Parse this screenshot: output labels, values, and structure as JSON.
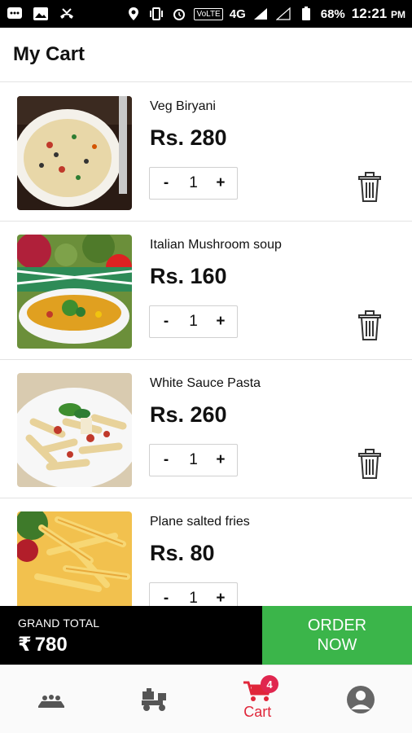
{
  "status_bar": {
    "volte": "VoLTE",
    "network": "4G",
    "battery": "68%",
    "time": "12:21",
    "ampm": "PM"
  },
  "header": {
    "title": "My Cart"
  },
  "cart": {
    "items": [
      {
        "name": "Veg Biryani",
        "price": "Rs. 280",
        "quantity": "1"
      },
      {
        "name": "Italian Mushroom soup",
        "price": "Rs. 160",
        "quantity": "1"
      },
      {
        "name": "White Sauce Pasta",
        "price": "Rs. 260",
        "quantity": "1"
      },
      {
        "name": "Plane salted fries",
        "price": "Rs. 80",
        "quantity": "1"
      }
    ],
    "minus_label": "-",
    "plus_label": "+"
  },
  "total": {
    "label": "GRAND TOTAL",
    "currency": "₹",
    "amount": "780",
    "order_button": "ORDER\nNOW"
  },
  "bottom_nav": {
    "items": [
      {
        "icon": "restaurant-icon",
        "label": ""
      },
      {
        "icon": "delivery-icon",
        "label": ""
      },
      {
        "icon": "cart-icon",
        "label": "Cart",
        "badge": "4"
      },
      {
        "icon": "profile-icon",
        "label": ""
      }
    ]
  },
  "colors": {
    "accent_green": "#3bb54a",
    "active_red": "#e0263a",
    "badge": "#e0264f"
  }
}
